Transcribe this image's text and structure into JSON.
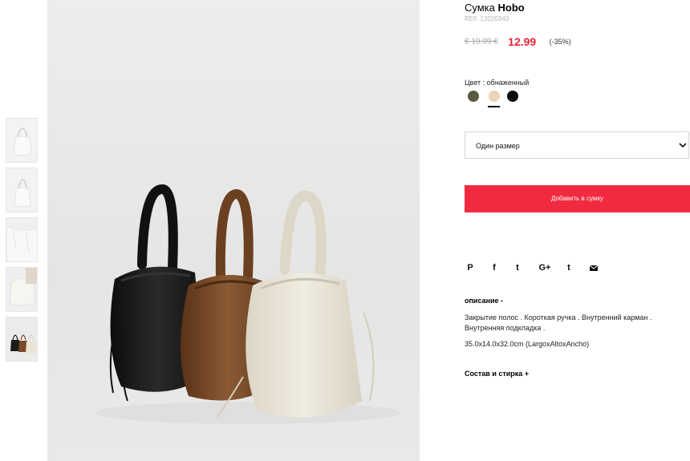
{
  "product": {
    "title_prefix": "Сумка",
    "title_name": "Hobo",
    "ref": "REF. 13020343"
  },
  "price": {
    "old": "€ 19.99 €",
    "new": "12.99",
    "discount": "(-35%)"
  },
  "color": {
    "label": "Цвет : обнаженный",
    "swatches": [
      {
        "name": "olive",
        "hex": "#5a5a40"
      },
      {
        "name": "nude",
        "hex": "#edd3b8"
      },
      {
        "name": "black",
        "hex": "#0a0a0a"
      }
    ],
    "selected": "nude"
  },
  "size": {
    "selected": "Один размер"
  },
  "cart": {
    "add_label": "Добавить в сумку"
  },
  "social": [
    "pinterest-icon",
    "facebook-icon",
    "twitter-icon",
    "google-plus-icon",
    "tumblr-icon",
    "email-icon"
  ],
  "social_glyphs": {
    "pinterest": "P",
    "facebook": "f",
    "twitter": "t",
    "google_plus": "G+",
    "tumblr": "t"
  },
  "description": {
    "toggle": "описание -",
    "text": "Закрытие полос . Короткая ручка . Внутренний карман . Внутренняя подкладка .",
    "dimensions": "35.0x14.0x32.0cm (LargoxAltoxAncho)"
  },
  "composition": {
    "toggle": "Состав и стирка +"
  },
  "gallery": {
    "thumbnails": [
      "thumb-front",
      "thumb-side",
      "thumb-detail",
      "thumb-model",
      "thumb-all-colors"
    ],
    "bag_colors": {
      "black": "#1b1b1b",
      "brown": "#7a4a28",
      "cream": "#e9e4d6"
    }
  },
  "colors": {
    "accent": "#f22a3f",
    "price_red": "#e5243b"
  }
}
